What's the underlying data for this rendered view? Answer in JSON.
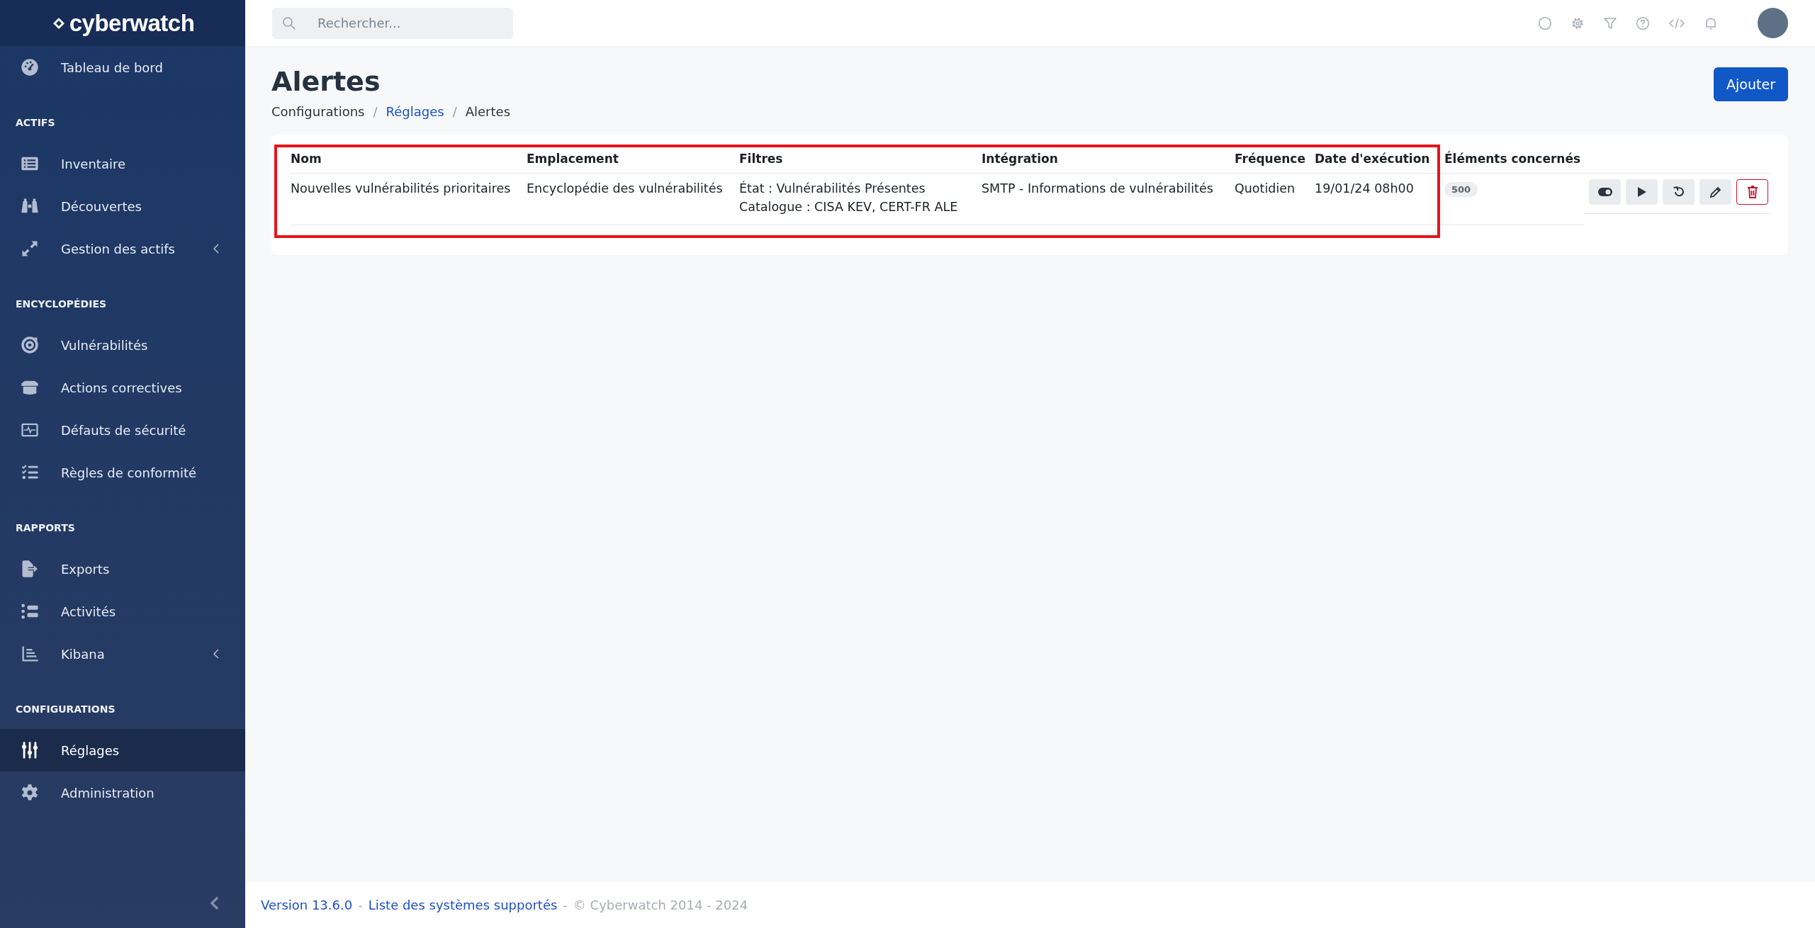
{
  "brand": {
    "name": "cyberwatch"
  },
  "search": {
    "placeholder": "Rechercher..."
  },
  "sidebar": {
    "sections": [
      {
        "items": [
          {
            "label": "Tableau de bord",
            "expandable": false,
            "selected": false
          }
        ]
      },
      {
        "heading": "ACTIFS",
        "items": [
          {
            "label": "Inventaire",
            "expandable": false,
            "selected": false
          },
          {
            "label": "Découvertes",
            "expandable": false,
            "selected": false
          },
          {
            "label": "Gestion des actifs",
            "expandable": true,
            "selected": false
          }
        ]
      },
      {
        "heading": "ENCYCLOPÉDIES",
        "items": [
          {
            "label": "Vulnérabilités",
            "expandable": false,
            "selected": false
          },
          {
            "label": "Actions correctives",
            "expandable": false,
            "selected": false
          },
          {
            "label": "Défauts de sécurité",
            "expandable": false,
            "selected": false
          },
          {
            "label": "Règles de conformité",
            "expandable": false,
            "selected": false
          }
        ]
      },
      {
        "heading": "RAPPORTS",
        "items": [
          {
            "label": "Exports",
            "expandable": false,
            "selected": false
          },
          {
            "label": "Activités",
            "expandable": false,
            "selected": false
          },
          {
            "label": "Kibana",
            "expandable": true,
            "selected": false
          }
        ]
      },
      {
        "heading": "CONFIGURATIONS",
        "items": [
          {
            "label": "Réglages",
            "expandable": false,
            "selected": true
          },
          {
            "label": "Administration",
            "expandable": false,
            "selected": false
          }
        ]
      }
    ]
  },
  "page": {
    "title": "Alertes",
    "breadcrumbs": [
      {
        "label": "Configurations",
        "link": false
      },
      {
        "separator": "/",
        "label": "Réglages",
        "link": true
      },
      {
        "separator": "/",
        "label": "Alertes",
        "link": false
      }
    ],
    "add_button": "Ajouter"
  },
  "table": {
    "columns": [
      "Nom",
      "Emplacement",
      "Filtres",
      "Intégration",
      "Fréquence",
      "Date d'exécution",
      "Éléments concernés"
    ],
    "rows": [
      {
        "name": "Nouvelles vulnérabilités prioritaires",
        "location": "Encyclopédie des vulnérabilités",
        "filters": [
          "État : Vulnérabilités Présentes",
          "Catalogue : CISA KEV, CERT-FR ALE"
        ],
        "integration": "SMTP - Informations de vulnérabilités",
        "frequency": "Quotidien",
        "date": "19/01/24 08h00",
        "count": "500"
      }
    ]
  },
  "footer": {
    "version": "Version 13.6.0",
    "separator_1": "-",
    "systems_link": "Liste des systèmes supportés",
    "separator_2": "-",
    "copyright": "© Cyberwatch 2014 - 2024"
  }
}
